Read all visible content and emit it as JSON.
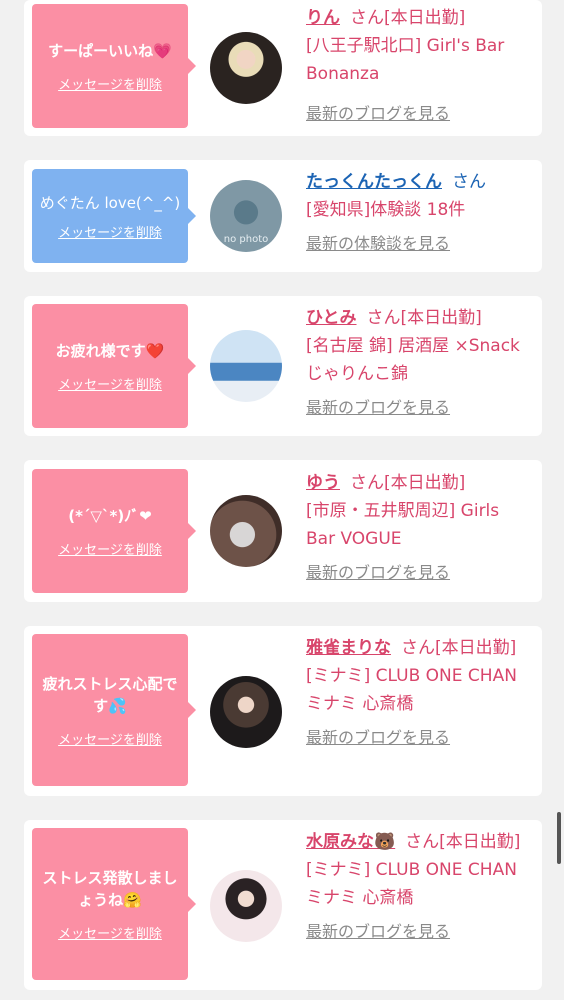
{
  "items": [
    {
      "message": "すーぱーいいね💗",
      "delete_label": "メッセージを削除",
      "name": "りん",
      "san": "さん[本日出勤]",
      "shop": "[八王子駅北口] Girl's Bar Bonanza",
      "blog": "最新のブログを見る",
      "bubble_color": "pink",
      "avatar": "photo-blonde"
    },
    {
      "message": "めぐたん love(^_^)",
      "delete_label": "メッセージを削除",
      "name": "たっくんたっくん",
      "san": "さん",
      "shop": "[愛知県]体験談 18件",
      "blog": "最新の体験談を見る",
      "bubble_color": "blue",
      "avatar": "no-photo",
      "avatar_text": "no photo"
    },
    {
      "message": "お疲れ様です❤️",
      "delete_label": "メッセージを削除",
      "name": "ひとみ",
      "san": "さん[本日出勤]",
      "shop": "[名古屋 錦] 居酒屋 ×Snack じゃりんこ錦",
      "blog": "最新のブログを見る",
      "bubble_color": "pink",
      "avatar": "photo-sea"
    },
    {
      "message": "(*´▽`*)ﾉﾞ❤",
      "delete_label": "メッセージを削除",
      "name": "ゆう",
      "san": "さん[本日出勤]",
      "shop": "[市原・五井駅周辺] Girls Bar VOGUE",
      "blog": "最新のブログを見る",
      "bubble_color": "pink",
      "avatar": "photo-mask"
    },
    {
      "message": "疲れストレス心配です💦",
      "delete_label": "メッセージを削除",
      "name": "雅雀まりな",
      "san": "さん[本日出勤]",
      "shop": "[ミナミ] CLUB ONE CHAN ミナミ 心斎橋",
      "blog": "最新のブログを見る",
      "bubble_color": "pink",
      "avatar": "photo-dark"
    },
    {
      "message": "ストレス発散しましょうね🤗",
      "delete_label": "メッセージを削除",
      "name": "水原みな🐻",
      "san": "さん[本日出勤]",
      "shop": "[ミナミ] CLUB ONE CHAN ミナミ 心斎橋",
      "blog": "最新のブログを見る",
      "bubble_color": "pink",
      "avatar": "photo-light"
    }
  ]
}
